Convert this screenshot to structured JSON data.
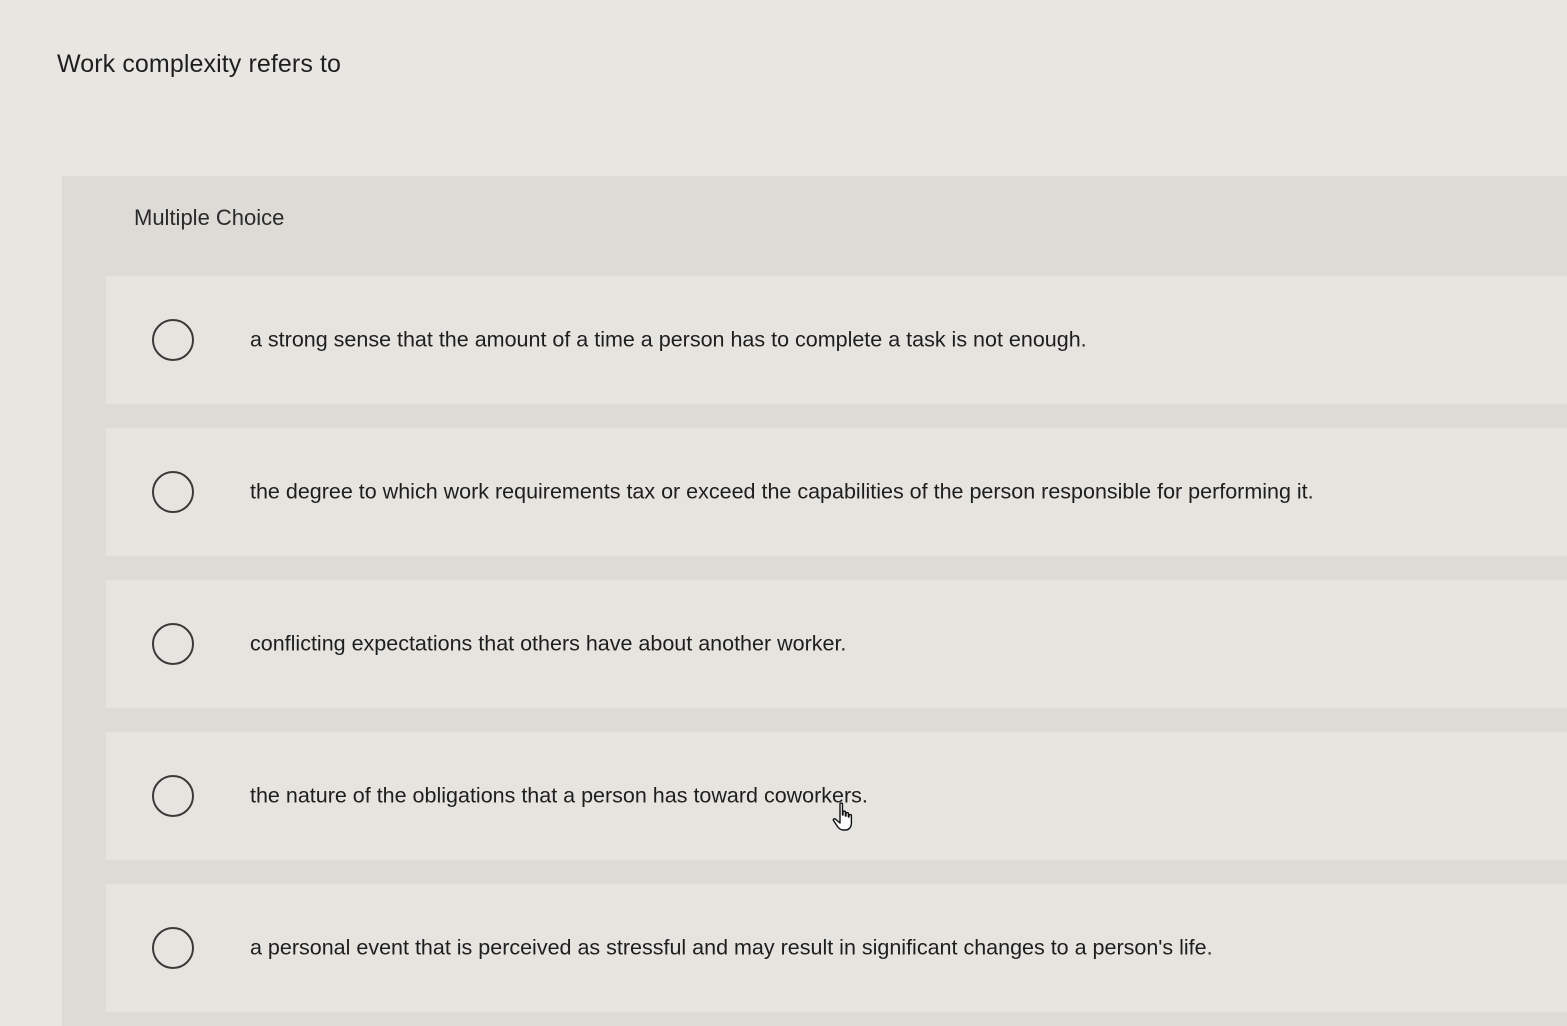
{
  "question": {
    "text": "Work complexity refers to"
  },
  "panel": {
    "label": "Multiple Choice"
  },
  "options": [
    {
      "text": "a strong sense that the amount of a time a person has to complete a task is not enough."
    },
    {
      "text": "the degree to which work requirements tax or exceed the capabilities of the person responsible for performing it."
    },
    {
      "text": "conflicting expectations that others have about another worker."
    },
    {
      "text": "the nature of the obligations that a person has toward coworkers."
    },
    {
      "text": "a personal event that is perceived as stressful and may result in significant changes to a person's life."
    }
  ],
  "icons": {
    "radio": "radio-button-icon",
    "cursor": "hand-pointer-cursor-icon"
  }
}
